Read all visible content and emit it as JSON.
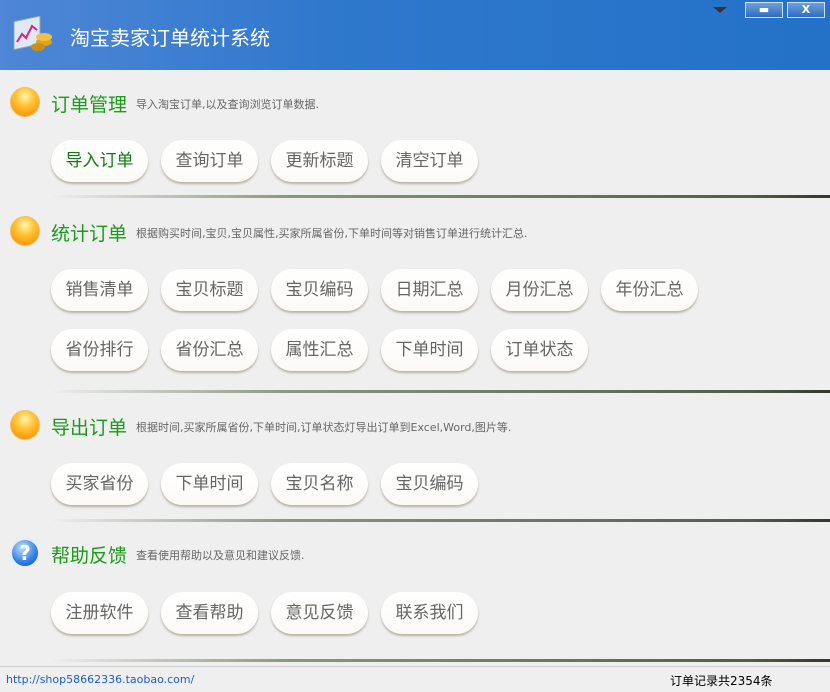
{
  "window": {
    "title": "淘宝卖家订单统计系统",
    "minimize_label": "▬",
    "close_label": "X"
  },
  "sections": [
    {
      "title": "订单管理",
      "desc": "导入淘宝订单,以及查询浏览订单数据.",
      "icon": "orange-ball-icon",
      "buttons": [
        "导入订单",
        "查询订单",
        "更新标题",
        "清空订单"
      ]
    },
    {
      "title": "统计订单",
      "desc": "根据购买时间,宝贝,宝贝属性,买家所属省份,下单时间等对销售订单进行统计汇总.",
      "icon": "orange-ball-icon",
      "buttons": [
        "销售清单",
        "宝贝标题",
        "宝贝编码",
        "日期汇总",
        "月份汇总",
        "年份汇总",
        "省份排行",
        "省份汇总",
        "属性汇总",
        "下单时间",
        "订单状态"
      ]
    },
    {
      "title": "导出订单",
      "desc": "根据时间,买家所属省份,下单时间,订单状态灯导出订单到Excel,Word,图片等.",
      "icon": "orange-ball-icon",
      "buttons": [
        "买家省份",
        "下单时间",
        "宝贝名称",
        "宝贝编码"
      ]
    },
    {
      "title": "帮助反馈",
      "desc": "查看使用帮助以及意见和建议反馈.",
      "icon": "help-icon",
      "icon_glyph": "?",
      "buttons": [
        "注册软件",
        "查看帮助",
        "意见反馈",
        "联系我们"
      ]
    }
  ],
  "status": {
    "link": "http://shop58662336.taobao.com/",
    "count": "订单记录共2354条"
  }
}
